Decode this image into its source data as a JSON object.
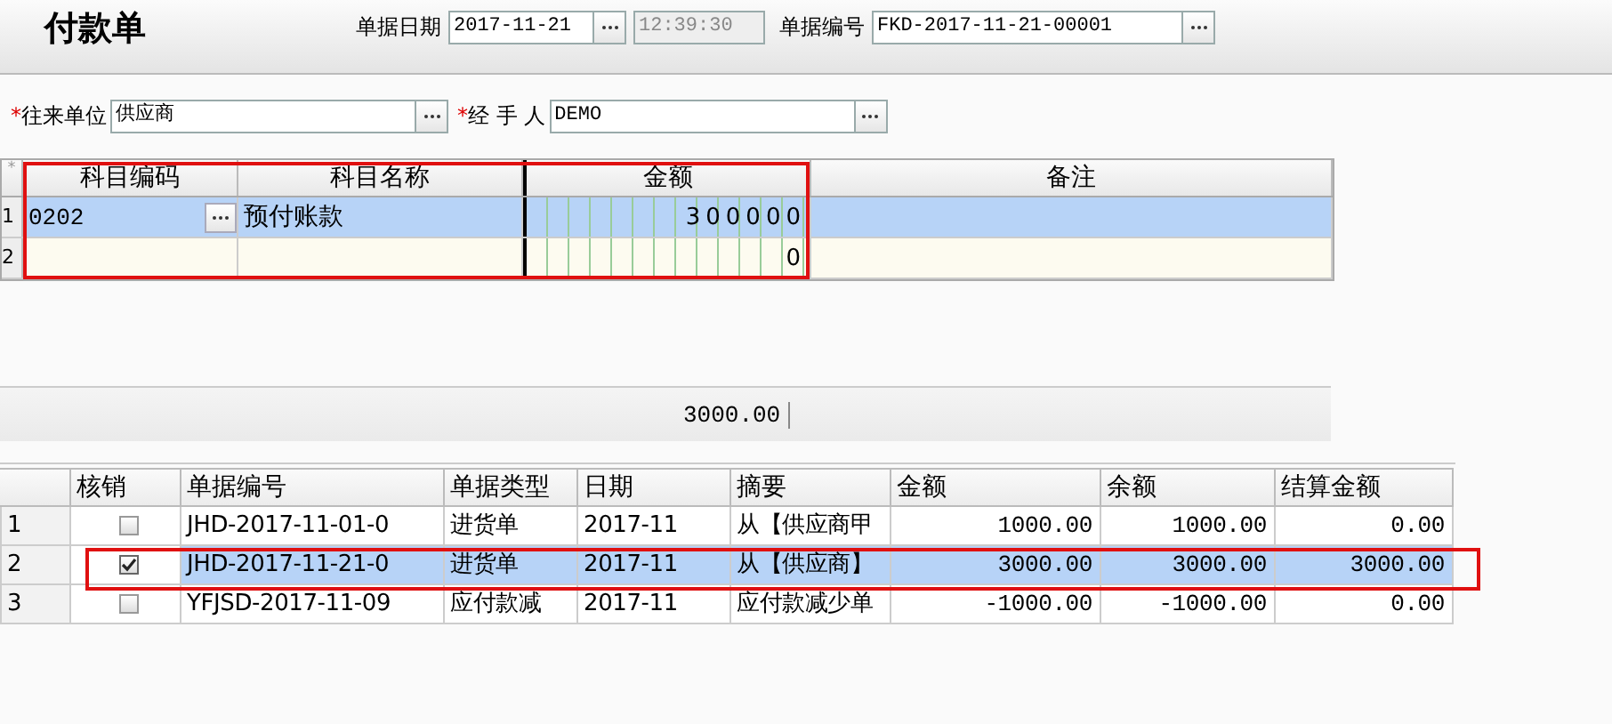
{
  "title": "付款单",
  "header_fields": [
    {
      "label": "单据日期",
      "value": "2017-11-21",
      "time": "12:39:30",
      "time_disabled": true
    },
    {
      "label": "单据编号",
      "value": "FKD-2017-11-21-00001"
    }
  ],
  "party_fields": [
    {
      "label": "往来单位",
      "required_mark": "*",
      "value": "供应商"
    },
    {
      "label": "经 手 人",
      "required_mark": "*",
      "value": "DEMO"
    }
  ],
  "entry_table": {
    "corner": "*",
    "columns": [
      "科目编码",
      "科目名称",
      "金额",
      "备注"
    ],
    "rows": [
      {
        "index": "1",
        "code": "0202",
        "name": "预付账款",
        "amount": "300000",
        "selected": true
      },
      {
        "index": "2",
        "code": "",
        "name": "",
        "amount": "0",
        "selected": false
      }
    ]
  },
  "total": "3000.00",
  "settle_table": {
    "columns": [
      "",
      "核销",
      "单据编号",
      "单据类型",
      "日期",
      "摘要",
      "金额",
      "余额",
      "结算金额"
    ],
    "rows": [
      {
        "checked": false,
        "selected": false,
        "cells": [
          "1",
          "",
          "JHD-2017-11-01-0",
          "进货单",
          "2017-11",
          "从【供应商甲",
          "1000.00",
          "1000.00",
          "0.00"
        ]
      },
      {
        "checked": true,
        "selected": true,
        "cells": [
          "2",
          "",
          "JHD-2017-11-21-0",
          "进货单",
          "2017-11",
          "从【供应商】",
          "3000.00",
          "3000.00",
          "3000.00"
        ]
      },
      {
        "checked": false,
        "selected": false,
        "cells": [
          "3",
          "",
          "YFJSD-2017-11-09",
          "应付款减",
          "2017-11",
          "应付款减少单",
          "-1000.00",
          "-1000.00",
          "0.00"
        ]
      }
    ]
  }
}
